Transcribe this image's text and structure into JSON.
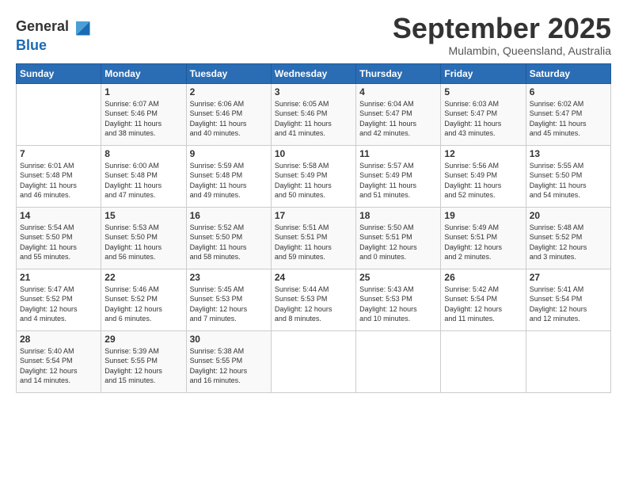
{
  "logo": {
    "line1": "General",
    "line2": "Blue"
  },
  "title": "September 2025",
  "subtitle": "Mulambin, Queensland, Australia",
  "days_header": [
    "Sunday",
    "Monday",
    "Tuesday",
    "Wednesday",
    "Thursday",
    "Friday",
    "Saturday"
  ],
  "weeks": [
    [
      {
        "day": "",
        "info": ""
      },
      {
        "day": "1",
        "info": "Sunrise: 6:07 AM\nSunset: 5:46 PM\nDaylight: 11 hours\nand 38 minutes."
      },
      {
        "day": "2",
        "info": "Sunrise: 6:06 AM\nSunset: 5:46 PM\nDaylight: 11 hours\nand 40 minutes."
      },
      {
        "day": "3",
        "info": "Sunrise: 6:05 AM\nSunset: 5:46 PM\nDaylight: 11 hours\nand 41 minutes."
      },
      {
        "day": "4",
        "info": "Sunrise: 6:04 AM\nSunset: 5:47 PM\nDaylight: 11 hours\nand 42 minutes."
      },
      {
        "day": "5",
        "info": "Sunrise: 6:03 AM\nSunset: 5:47 PM\nDaylight: 11 hours\nand 43 minutes."
      },
      {
        "day": "6",
        "info": "Sunrise: 6:02 AM\nSunset: 5:47 PM\nDaylight: 11 hours\nand 45 minutes."
      }
    ],
    [
      {
        "day": "7",
        "info": "Sunrise: 6:01 AM\nSunset: 5:48 PM\nDaylight: 11 hours\nand 46 minutes."
      },
      {
        "day": "8",
        "info": "Sunrise: 6:00 AM\nSunset: 5:48 PM\nDaylight: 11 hours\nand 47 minutes."
      },
      {
        "day": "9",
        "info": "Sunrise: 5:59 AM\nSunset: 5:48 PM\nDaylight: 11 hours\nand 49 minutes."
      },
      {
        "day": "10",
        "info": "Sunrise: 5:58 AM\nSunset: 5:49 PM\nDaylight: 11 hours\nand 50 minutes."
      },
      {
        "day": "11",
        "info": "Sunrise: 5:57 AM\nSunset: 5:49 PM\nDaylight: 11 hours\nand 51 minutes."
      },
      {
        "day": "12",
        "info": "Sunrise: 5:56 AM\nSunset: 5:49 PM\nDaylight: 11 hours\nand 52 minutes."
      },
      {
        "day": "13",
        "info": "Sunrise: 5:55 AM\nSunset: 5:50 PM\nDaylight: 11 hours\nand 54 minutes."
      }
    ],
    [
      {
        "day": "14",
        "info": "Sunrise: 5:54 AM\nSunset: 5:50 PM\nDaylight: 11 hours\nand 55 minutes."
      },
      {
        "day": "15",
        "info": "Sunrise: 5:53 AM\nSunset: 5:50 PM\nDaylight: 11 hours\nand 56 minutes."
      },
      {
        "day": "16",
        "info": "Sunrise: 5:52 AM\nSunset: 5:50 PM\nDaylight: 11 hours\nand 58 minutes."
      },
      {
        "day": "17",
        "info": "Sunrise: 5:51 AM\nSunset: 5:51 PM\nDaylight: 11 hours\nand 59 minutes."
      },
      {
        "day": "18",
        "info": "Sunrise: 5:50 AM\nSunset: 5:51 PM\nDaylight: 12 hours\nand 0 minutes."
      },
      {
        "day": "19",
        "info": "Sunrise: 5:49 AM\nSunset: 5:51 PM\nDaylight: 12 hours\nand 2 minutes."
      },
      {
        "day": "20",
        "info": "Sunrise: 5:48 AM\nSunset: 5:52 PM\nDaylight: 12 hours\nand 3 minutes."
      }
    ],
    [
      {
        "day": "21",
        "info": "Sunrise: 5:47 AM\nSunset: 5:52 PM\nDaylight: 12 hours\nand 4 minutes."
      },
      {
        "day": "22",
        "info": "Sunrise: 5:46 AM\nSunset: 5:52 PM\nDaylight: 12 hours\nand 6 minutes."
      },
      {
        "day": "23",
        "info": "Sunrise: 5:45 AM\nSunset: 5:53 PM\nDaylight: 12 hours\nand 7 minutes."
      },
      {
        "day": "24",
        "info": "Sunrise: 5:44 AM\nSunset: 5:53 PM\nDaylight: 12 hours\nand 8 minutes."
      },
      {
        "day": "25",
        "info": "Sunrise: 5:43 AM\nSunset: 5:53 PM\nDaylight: 12 hours\nand 10 minutes."
      },
      {
        "day": "26",
        "info": "Sunrise: 5:42 AM\nSunset: 5:54 PM\nDaylight: 12 hours\nand 11 minutes."
      },
      {
        "day": "27",
        "info": "Sunrise: 5:41 AM\nSunset: 5:54 PM\nDaylight: 12 hours\nand 12 minutes."
      }
    ],
    [
      {
        "day": "28",
        "info": "Sunrise: 5:40 AM\nSunset: 5:54 PM\nDaylight: 12 hours\nand 14 minutes."
      },
      {
        "day": "29",
        "info": "Sunrise: 5:39 AM\nSunset: 5:55 PM\nDaylight: 12 hours\nand 15 minutes."
      },
      {
        "day": "30",
        "info": "Sunrise: 5:38 AM\nSunset: 5:55 PM\nDaylight: 12 hours\nand 16 minutes."
      },
      {
        "day": "",
        "info": ""
      },
      {
        "day": "",
        "info": ""
      },
      {
        "day": "",
        "info": ""
      },
      {
        "day": "",
        "info": ""
      }
    ]
  ]
}
